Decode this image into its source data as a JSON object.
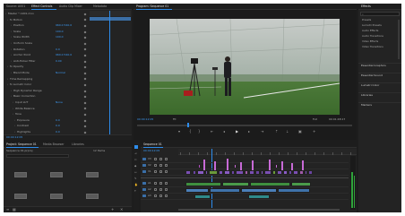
{
  "effect_controls": {
    "tabs": [
      "Source: A001",
      "Effect Controls",
      "Audio Clip Mixer",
      "Metadata"
    ],
    "active_tab": 1,
    "rows": [
      {
        "label": "Master * A001.mov",
        "value": ""
      },
      {
        "label": "fx Motion",
        "value": ""
      },
      {
        "label": "Position",
        "value": "960.0  540.0"
      },
      {
        "label": "Scale",
        "value": "100.0"
      },
      {
        "label": "Scale Width",
        "value": "100.0"
      },
      {
        "label": "Uniform Scale",
        "value": ""
      },
      {
        "label": "Rotation",
        "value": "0.0"
      },
      {
        "label": "Anchor Point",
        "value": "960.0  540.0"
      },
      {
        "label": "Anti-flicker Filter",
        "value": "0.00"
      },
      {
        "label": "fx Opacity",
        "value": ""
      },
      {
        "label": "Blend Mode",
        "value": "Normal"
      },
      {
        "label": "Time Remapping",
        "value": ""
      },
      {
        "label": "fx Lumetri Color",
        "value": ""
      },
      {
        "label": "High Dynamic Range",
        "value": ""
      },
      {
        "label": "Basic Correction",
        "value": ""
      },
      {
        "label": "Input LUT",
        "value": "None"
      },
      {
        "label": "White Balance",
        "value": ""
      },
      {
        "label": "Tone",
        "value": ""
      },
      {
        "label": "Exposure",
        "value": "0.0"
      },
      {
        "label": "Contrast",
        "value": "0.0"
      },
      {
        "label": "Highlights",
        "value": "0.0"
      }
    ],
    "timecode": "00:00:12:05"
  },
  "program_monitor": {
    "title": "Program: Sequence 01",
    "timecode_left": "00:00:12:05",
    "fit": "Fit",
    "quality": "Full",
    "timecode_right": "00:01:48:17"
  },
  "project": {
    "tabs": [
      "Project: Sequence 01",
      "Media Browser",
      "Libraries"
    ],
    "active_tab": 0,
    "path": "Sequence 01.prproj",
    "item_count": "12 Items"
  },
  "timeline": {
    "tab": "Sequence 01",
    "timecode": "00:00:12:05",
    "video_tracks": [
      "V3",
      "V2",
      "V1"
    ],
    "audio_tracks": [
      "A1",
      "A2",
      "A3"
    ]
  },
  "effects": {
    "tab": "Effects",
    "items": [
      "Presets",
      "Lumetri Presets",
      "Audio Effects",
      "Audio Transitions",
      "Video Effects",
      "Video Transitions"
    ],
    "sections": [
      "Essential Graphics",
      "Essential Sound",
      "Lumetri Color",
      "Libraries",
      "Markers"
    ]
  },
  "colors": {
    "accent": "#2d8ceb",
    "value_blue": "#3d9bf5",
    "playhead": "#2d8ceb"
  }
}
